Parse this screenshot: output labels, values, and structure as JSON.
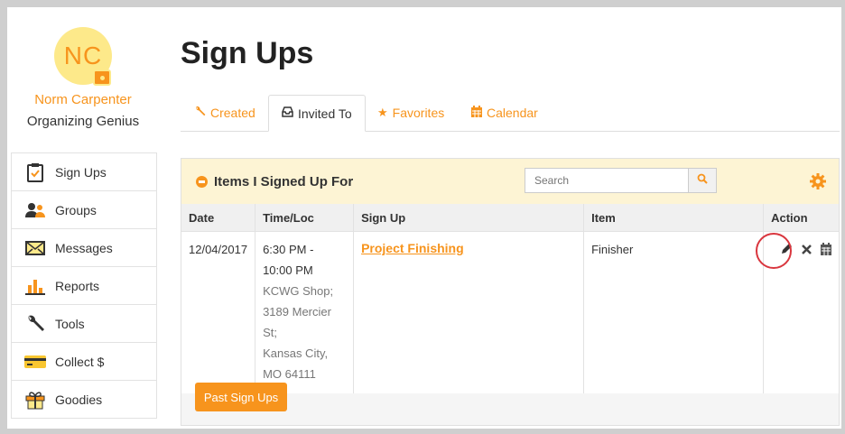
{
  "user": {
    "initials": "NC",
    "name": "Norm Carpenter",
    "role": "Organizing Genius"
  },
  "nav": [
    {
      "label": "Sign Ups",
      "icon": "clipboard-icon"
    },
    {
      "label": "Groups",
      "icon": "groups-icon"
    },
    {
      "label": "Messages",
      "icon": "envelope-icon"
    },
    {
      "label": "Reports",
      "icon": "bar-chart-icon"
    },
    {
      "label": "Tools",
      "icon": "wrench-icon"
    },
    {
      "label": "Collect $",
      "icon": "credit-card-icon"
    },
    {
      "label": "Goodies",
      "icon": "gift-icon"
    }
  ],
  "page_title": "Sign Ups",
  "tabs": [
    {
      "label": "Created",
      "icon": "wrench-icon"
    },
    {
      "label": "Invited To",
      "icon": "inbox-icon",
      "active": true
    },
    {
      "label": "Favorites",
      "icon": "star-icon"
    },
    {
      "label": "Calendar",
      "icon": "calendar-icon"
    }
  ],
  "panel": {
    "title": "Items I Signed Up For",
    "search_placeholder": "Search",
    "columns": [
      "Date",
      "Time/Loc",
      "Sign Up",
      "Item",
      "Action"
    ],
    "rows": [
      {
        "date": "12/04/2017",
        "time": "6:30 PM - 10:00 PM",
        "loc_lines": [
          "KCWG Shop;",
          "3189 Mercier St;",
          "Kansas City,",
          "MO 64111"
        ],
        "signup": "Project Finishing",
        "item": "Finisher"
      }
    ],
    "past_button": "Past Sign Ups"
  },
  "colors": {
    "accent": "#f7941d",
    "header_bg": "#fdf4d4",
    "avatar_bg": "#fde98a",
    "highlight_ring": "#d9363e"
  }
}
